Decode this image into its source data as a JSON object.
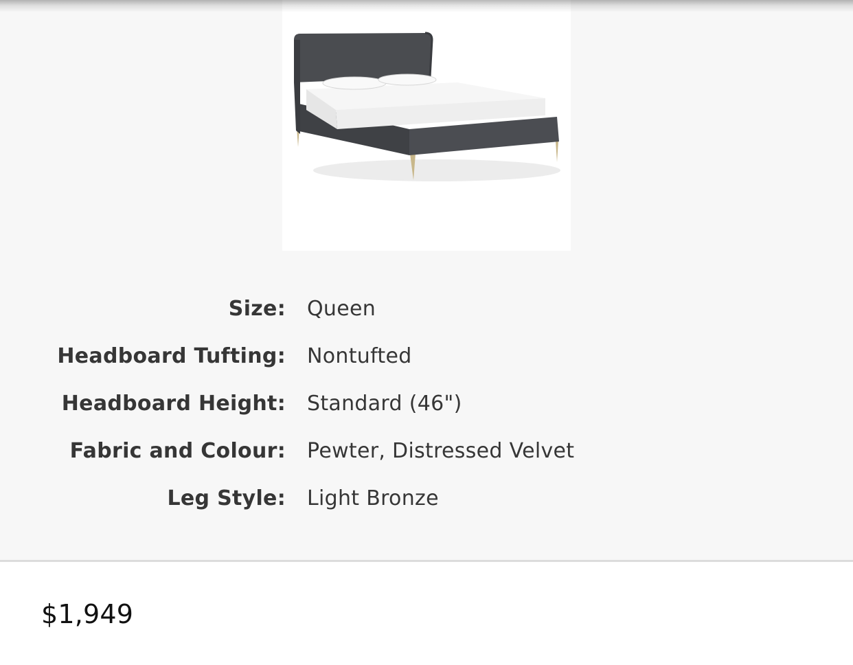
{
  "product": {
    "image_alt": "Upholstered bed, pewter distressed velvet, light bronze legs"
  },
  "options": [
    {
      "label": "Size:",
      "value": "Queen"
    },
    {
      "label": "Headboard Tufting:",
      "value": "Nontufted"
    },
    {
      "label": "Headboard Height:",
      "value": "Standard (46\")"
    },
    {
      "label": "Fabric and Colour:",
      "value": "Pewter, Distressed Velvet"
    },
    {
      "label": "Leg Style:",
      "value": "Light Bronze"
    }
  ],
  "price": "$1,949",
  "colors": {
    "panel_background": "#f7f7f7",
    "text": "#363636",
    "price_text": "#111111",
    "fabric": "#4a4c50",
    "leg_bronze": "#c8b78a"
  }
}
